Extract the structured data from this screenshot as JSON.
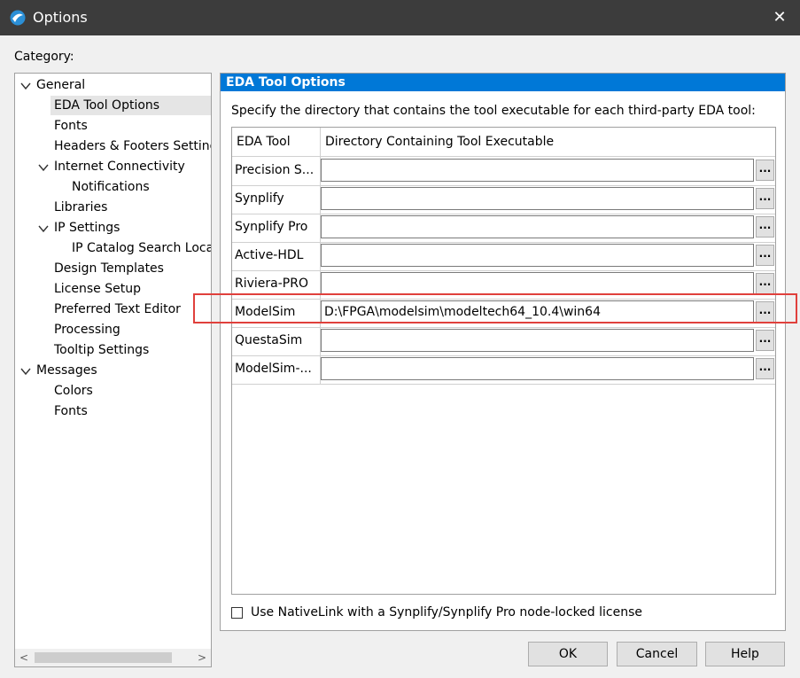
{
  "window": {
    "title": "Options",
    "close_glyph": "✕"
  },
  "category": {
    "label": "Category:",
    "items": [
      {
        "label": "General"
      },
      {
        "label": "EDA Tool Options"
      },
      {
        "label": "Fonts"
      },
      {
        "label": "Headers & Footers Setting"
      },
      {
        "label": "Internet Connectivity"
      },
      {
        "label": "Notifications"
      },
      {
        "label": "Libraries"
      },
      {
        "label": "IP Settings"
      },
      {
        "label": "IP Catalog Search Locat"
      },
      {
        "label": "Design Templates"
      },
      {
        "label": "License Setup"
      },
      {
        "label": "Preferred Text Editor"
      },
      {
        "label": "Processing"
      },
      {
        "label": "Tooltip Settings"
      },
      {
        "label": "Messages"
      },
      {
        "label": "Colors"
      },
      {
        "label": "Fonts"
      }
    ]
  },
  "panel": {
    "header": "EDA Tool Options",
    "description": "Specify the directory that contains the tool executable for each third-party EDA tool:",
    "columns": [
      "EDA Tool",
      "Directory Containing Tool Executable"
    ],
    "browse_label": "...",
    "rows": [
      {
        "tool": "Precision S...",
        "directory": ""
      },
      {
        "tool": "Synplify",
        "directory": ""
      },
      {
        "tool": "Synplify Pro",
        "directory": ""
      },
      {
        "tool": "Active-HDL",
        "directory": ""
      },
      {
        "tool": "Riviera-PRO",
        "directory": ""
      },
      {
        "tool": "ModelSim",
        "directory": "D:\\FPGA\\modelsim\\modeltech64_10.4\\win64"
      },
      {
        "tool": "QuestaSim",
        "directory": ""
      },
      {
        "tool": "ModelSim-...",
        "directory": ""
      }
    ],
    "nativelink": {
      "label": "Use NativeLink with a Synplify/Synplify Pro node-locked license",
      "checked": false
    }
  },
  "buttons": {
    "ok": "OK",
    "cancel": "Cancel",
    "help": "Help"
  },
  "colors": {
    "titlebar": "#3c3c3c",
    "panel_header": "#0078d7",
    "highlight_box": "#e0403c",
    "selected_item": "#e5e5e5"
  },
  "icons": [
    "app-icon",
    "close-icon",
    "expand-icon",
    "browse-icon",
    "scroll-left-icon",
    "scroll-right-icon"
  ]
}
